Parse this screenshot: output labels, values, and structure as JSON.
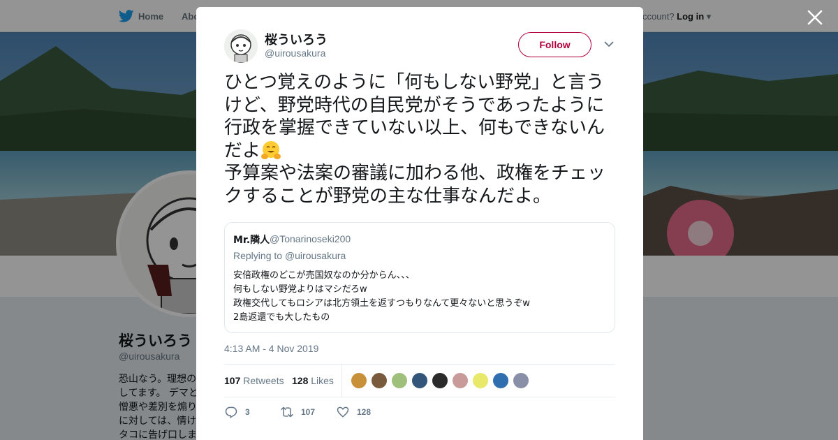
{
  "topbar": {
    "home_label": "Home",
    "about_label": "Abo",
    "account_prompt": "ccount?",
    "login_label": "Log in"
  },
  "profile": {
    "name": "桜ういろう",
    "handle": "@uirousakura",
    "bio": "恐山なう。理想の\nしてます。 デマと\n憎悪や差別を煽り\nに対しては、情け\nタコに告げ口しま"
  },
  "tweet": {
    "author_name": "桜ういろう",
    "author_handle": "@uirousakura",
    "follow_label": "Follow",
    "text_part1": "ひとつ覚えのように「何もしない野党」と言うけど、野党時代の自民党がそうであったように行政を掌握できていない以上、何もできないんだよ",
    "text_part2": "\n予算案や法案の審議に加わる他、政権をチェックすることが野党の主な仕事なんだよ。",
    "timestamp": "4:13 AM - 4 Nov 2019",
    "retweets_count": "107",
    "retweets_label": "Retweets",
    "likes_count": "128",
    "likes_label": "Likes",
    "reply_count": "3",
    "retweet_action_count": "107",
    "like_action_count": "128"
  },
  "quoted_tweet": {
    "author_name": "Mr.隣人",
    "author_handle": "@Tonarinoseki200",
    "replying_to_label": "Replying to ",
    "replying_to_handle": "@uirousakura",
    "body": "安倍政権のどこが売国奴なのか分からん、、、\n何もしない野党よりはマシだろw\n政権交代してもロシアは北方領土を返すつもりなんて更々ないと思うぞw\n2島返還でも大したもの"
  },
  "colors": {
    "follow_accent": "#b2003a",
    "secondary_text": "#657786",
    "primary_text": "#14171a"
  },
  "icons": [
    "twitter-bird-icon",
    "close-icon",
    "chevron-down-icon",
    "reply-icon",
    "retweet-icon",
    "like-icon",
    "hugging-face-emoji"
  ]
}
